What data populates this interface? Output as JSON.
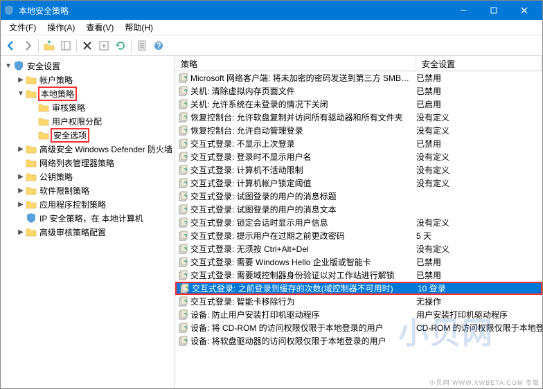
{
  "window": {
    "title": "本地安全策略"
  },
  "menus": {
    "file": "文件(F)",
    "action": "操作(A)",
    "view": "查看(V)",
    "help": "帮助(H)"
  },
  "tree": {
    "root": "安全设置",
    "items": [
      {
        "label": "帐户策略",
        "depth": 1,
        "expander": "▶",
        "icon": "folder"
      },
      {
        "label": "本地策略",
        "depth": 1,
        "expander": "▼",
        "icon": "folder",
        "highlight": true
      },
      {
        "label": "审核策略",
        "depth": 2,
        "expander": "",
        "icon": "folder"
      },
      {
        "label": "用户权限分配",
        "depth": 2,
        "expander": "",
        "icon": "folder"
      },
      {
        "label": "安全选项",
        "depth": 2,
        "expander": "",
        "icon": "folder",
        "highlight": true
      },
      {
        "label": "高级安全 Windows Defender 防火墙",
        "depth": 1,
        "expander": "▶",
        "icon": "folder"
      },
      {
        "label": "网络列表管理器策略",
        "depth": 1,
        "expander": "",
        "icon": "folder-net"
      },
      {
        "label": "公钥策略",
        "depth": 1,
        "expander": "▶",
        "icon": "folder"
      },
      {
        "label": "软件限制策略",
        "depth": 1,
        "expander": "▶",
        "icon": "folder"
      },
      {
        "label": "应用程序控制策略",
        "depth": 1,
        "expander": "▶",
        "icon": "folder"
      },
      {
        "label": "IP 安全策略，在 本地计算机",
        "depth": 1,
        "expander": "",
        "icon": "shield"
      },
      {
        "label": "高级审核策略配置",
        "depth": 1,
        "expander": "▶",
        "icon": "folder"
      }
    ]
  },
  "list": {
    "header_policy": "策略",
    "header_setting": "安全设置",
    "rows": [
      {
        "policy": "Microsoft 网络客户端: 将未加密的密码发送到第三方 SMB…",
        "setting": "已禁用"
      },
      {
        "policy": "关机: 清除虚拟内存页面文件",
        "setting": "已禁用"
      },
      {
        "policy": "关机: 允许系统在未登录的情况下关闭",
        "setting": "已启用"
      },
      {
        "policy": "恢复控制台: 允许软盘复制并访问所有驱动器和所有文件夹",
        "setting": "没有定义"
      },
      {
        "policy": "恢复控制台: 允许自动管理登录",
        "setting": "没有定义"
      },
      {
        "policy": "交互式登录: 不显示上次登录",
        "setting": "已禁用"
      },
      {
        "policy": "交互式登录: 登录时不显示用户名",
        "setting": "没有定义"
      },
      {
        "policy": "交互式登录: 计算机不活动限制",
        "setting": "没有定义"
      },
      {
        "policy": "交互式登录: 计算机帐户锁定阈值",
        "setting": "没有定义"
      },
      {
        "policy": "交互式登录: 试图登录的用户的消息标题",
        "setting": ""
      },
      {
        "policy": "交互式登录: 试图登录的用户的消息文本",
        "setting": ""
      },
      {
        "policy": "交互式登录: 锁定会话时显示用户信息",
        "setting": "没有定义"
      },
      {
        "policy": "交互式登录: 提示用户在过期之前更改密码",
        "setting": "5 天"
      },
      {
        "policy": "交互式登录: 无须按 Ctrl+Alt+Del",
        "setting": "没有定义"
      },
      {
        "policy": "交互式登录: 需要 Windows Hello 企业版或智能卡",
        "setting": "已禁用"
      },
      {
        "policy": "交互式登录: 需要域控制器身份验证以对工作站进行解锁",
        "setting": "已禁用"
      },
      {
        "policy": "交互式登录: 之前登录到缓存的次数(域控制器不可用时)",
        "setting": "10 登录",
        "selected": true,
        "highlight": true
      },
      {
        "policy": "交互式登录: 智能卡移除行为",
        "setting": "无操作"
      },
      {
        "policy": "设备: 防止用户安装打印机驱动程序",
        "setting": "用户安装打印机驱动程序"
      },
      {
        "policy": "设备: 将 CD-ROM 的访问权限仅限于本地登录的用户",
        "setting": "CD-ROM 的访问权限仅限于本地登录的用户"
      },
      {
        "policy": "设备: 将软盘驱动器的访问权限仅限于本地登录的用户",
        "setting": ""
      }
    ]
  },
  "watermark": "小贝网 WWW.XWBETA.COM 专版"
}
